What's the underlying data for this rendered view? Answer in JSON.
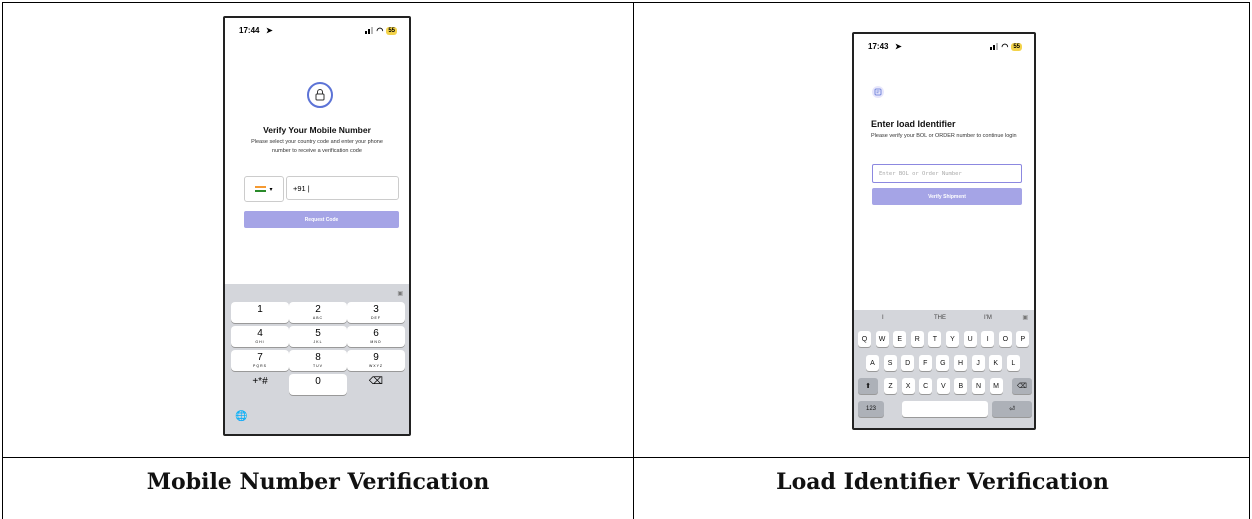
{
  "left": {
    "caption": "Mobile Number Verification",
    "status": {
      "time": "17:44",
      "battery": "55"
    },
    "title": "Verify Your Mobile Number",
    "subtitle": "Please select your country code and enter your phone number to receive a verification code",
    "phone_value": "+91 |",
    "button": "Request Code",
    "keypad": [
      {
        "d": "1",
        "l": ""
      },
      {
        "d": "2",
        "l": "ABC"
      },
      {
        "d": "3",
        "l": "DEF"
      },
      {
        "d": "4",
        "l": "GHI"
      },
      {
        "d": "5",
        "l": "JKL"
      },
      {
        "d": "6",
        "l": "MNO"
      },
      {
        "d": "7",
        "l": "PQRS"
      },
      {
        "d": "8",
        "l": "TUV"
      },
      {
        "d": "9",
        "l": "WXYZ"
      },
      {
        "d": "+*#",
        "l": ""
      },
      {
        "d": "0",
        "l": ""
      },
      {
        "d": "⌫",
        "l": ""
      }
    ]
  },
  "right": {
    "caption": "Load Identifier Verification",
    "status": {
      "time": "17:43",
      "battery": "55"
    },
    "title": "Enter load Identifier",
    "subtitle": "Please verify your BOL or ORDER number to continue login",
    "placeholder": "Enter BOL or Order Number",
    "button": "Verify Shipment",
    "suggestions": [
      "I",
      "THE",
      "I'M"
    ],
    "rows": [
      [
        "Q",
        "W",
        "E",
        "R",
        "T",
        "Y",
        "U",
        "I",
        "O",
        "P"
      ],
      [
        "A",
        "S",
        "D",
        "F",
        "G",
        "H",
        "J",
        "K",
        "L"
      ],
      [
        "Z",
        "X",
        "C",
        "V",
        "B",
        "N",
        "M"
      ]
    ],
    "numbers_key": "123"
  },
  "colors": {
    "accent": "#5c73d6",
    "button_disabled": "#a5a4e6"
  }
}
